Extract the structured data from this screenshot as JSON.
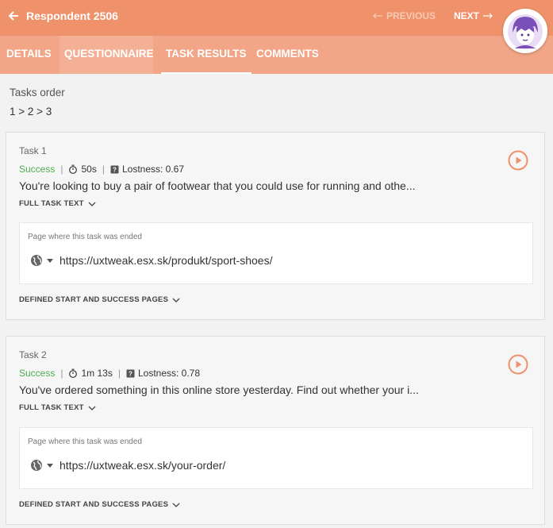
{
  "header": {
    "title": "Respondent 2506",
    "prev_label": "PREVIOUS",
    "next_label": "NEXT"
  },
  "tabs": [
    {
      "label": "DETAILS"
    },
    {
      "label": "QUESTIONNAIRE"
    },
    {
      "label": "TASK RESULTS"
    },
    {
      "label": "COMMENTS"
    }
  ],
  "tasks_order": {
    "label": "Tasks order",
    "value": "1 > 2 > 3"
  },
  "tasks": [
    {
      "title": "Task 1",
      "status": "Success",
      "time": "50s",
      "lostness": "Lostness: 0.67",
      "description": "You're looking to buy a pair of footwear that you could use for running and othe...",
      "full_text_label": "FULL TASK TEXT",
      "page_label": "Page where this task was ended",
      "page_url": "https://uxtweak.esx.sk/produkt/sport-shoes/",
      "defined_pages_label": "DEFINED START AND SUCCESS PAGES"
    },
    {
      "title": "Task 2",
      "status": "Success",
      "time": "1m 13s",
      "lostness": "Lostness: 0.78",
      "description": "You've ordered something in this online store yesterday. Find out whether your i...",
      "full_text_label": "FULL TASK TEXT",
      "page_label": "Page where this task was ended",
      "page_url": "https://uxtweak.esx.sk/your-order/",
      "defined_pages_label": "DEFINED START AND SUCCESS PAGES"
    }
  ],
  "colors": {
    "header_bg": "#ef916a",
    "tabbar_bg": "#f2a587",
    "success": "#4caf50",
    "accent": "#ef916a"
  }
}
